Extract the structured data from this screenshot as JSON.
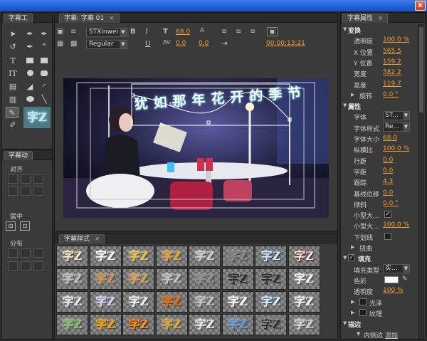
{
  "window": {
    "close_label": "x"
  },
  "tools_panel": {
    "tab": "字幕工"
  },
  "actions_panel": {
    "tab": "字幕动",
    "align": "对齐",
    "center": "居中",
    "distribute": "分布"
  },
  "editor": {
    "tab": "字幕: 字幕 01",
    "font_family": "STXinwei",
    "font_style": "Regular",
    "font_size": "68.0",
    "leading": "0.0",
    "kerning": "0.0",
    "tracking": "0.0",
    "timecode": "00:00:13:21",
    "title_text": "犹如那年花开的季节"
  },
  "styles_panel": {
    "tab": "字幕样式",
    "sample": "字Z"
  },
  "props_panel": {
    "tab": "字幕属性",
    "rows": [
      {
        "type": "head",
        "label": "变换"
      },
      {
        "type": "val",
        "label": "透明度",
        "value": "100.0 %"
      },
      {
        "type": "val",
        "label": "X 位置",
        "value": "565.5"
      },
      {
        "type": "val",
        "label": "Y 位置",
        "value": "159.2"
      },
      {
        "type": "val",
        "label": "宽度",
        "value": "582.2"
      },
      {
        "type": "val",
        "label": "高度",
        "value": "119.7"
      },
      {
        "type": "sub",
        "label": "旋转",
        "value": "0.0 °"
      },
      {
        "type": "head",
        "label": "属性"
      },
      {
        "type": "select",
        "label": "字体",
        "value": "ST..."
      },
      {
        "type": "select",
        "label": "字体样式",
        "value": "Re..."
      },
      {
        "type": "val",
        "label": "字体大小",
        "value": "68.0"
      },
      {
        "type": "val",
        "label": "纵横比",
        "value": "100.0 %"
      },
      {
        "type": "val",
        "label": "行距",
        "value": "0.0"
      },
      {
        "type": "val",
        "label": "字距",
        "value": "0.0"
      },
      {
        "type": "val",
        "label": "跟踪",
        "value": "4.3"
      },
      {
        "type": "val",
        "label": "基线位移",
        "value": "0.0"
      },
      {
        "type": "val",
        "label": "倾斜",
        "value": "0.0 °"
      },
      {
        "type": "check",
        "label": "小型大...",
        "checked": true
      },
      {
        "type": "val",
        "label": "小型大...",
        "value": "100.0 %"
      },
      {
        "type": "check",
        "label": "下划线",
        "checked": false
      },
      {
        "type": "sub",
        "label": "扭曲",
        "value": ""
      },
      {
        "type": "headcheck",
        "label": "填充"
      },
      {
        "type": "select",
        "label": "填充类型",
        "value": "实..."
      },
      {
        "type": "color",
        "label": "色彩"
      },
      {
        "type": "val",
        "label": "透明度",
        "value": "100 %"
      },
      {
        "type": "subcheck",
        "label": "光泽"
      },
      {
        "type": "subcheck",
        "label": "纹理"
      },
      {
        "type": "head",
        "label": "描边"
      },
      {
        "type": "inner",
        "label": "内侧边",
        "value": "添加"
      }
    ]
  },
  "colors": {
    "accent": "#f0a030",
    "panel": "#3a3a3a",
    "titlebar": "#1d5fd8",
    "glow": "#9fe8ff"
  }
}
